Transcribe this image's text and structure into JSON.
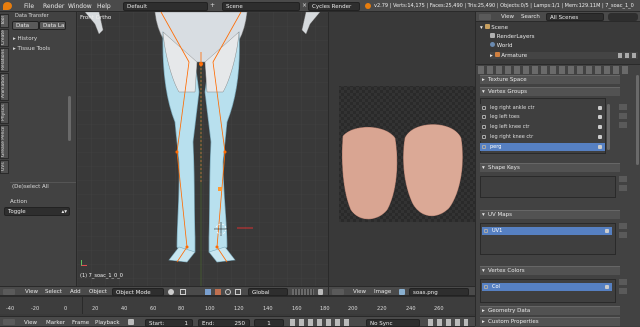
{
  "topbar": {
    "menus": [
      "File",
      "Render",
      "Window",
      "Help"
    ],
    "layout": "Default",
    "scene": "Scene",
    "engine": "Cycles Render",
    "stats": "v2.79 | Verts:14,175 | Faces:25,490 | Tris:25,490 | Objects:0/5 | Lamps:1/1 | Mem:129.11M | 7_soac_1_0"
  },
  "toolshelf": {
    "tabs": [
      "Tool",
      "Create",
      "Relations",
      "Animation",
      "Physics",
      "Grease Pencil",
      "UVs"
    ],
    "data_transfer": "Data Transfer",
    "data_btn": "Data",
    "data_la_btn": "Data La",
    "history": "History",
    "tissue_tools": "Tissue Tools",
    "operator_title": "(De)select All",
    "action_label": "Action",
    "action_value": "Toggle"
  },
  "viewport": {
    "label": "Front Ortho",
    "object_label": "(1) 7_soac_1_0_0",
    "header": {
      "view": "View",
      "select": "Select",
      "add": "Add",
      "object": "Object",
      "mode": "Object Mode",
      "orientation": "Global"
    }
  },
  "image_editor": {
    "header": {
      "view": "View",
      "image": "Image",
      "image_name": "soas.png"
    }
  },
  "outliner": {
    "view": "View",
    "search": "Search",
    "filter": "All Scenes",
    "items": [
      "Scene",
      "RenderLayers",
      "World",
      "Armature"
    ]
  },
  "properties": {
    "texture_space": "Texture Space",
    "vertex_groups": "Vertex Groups",
    "groups": [
      "leg right ankle ctr",
      "leg left toes",
      "leg left knee ctr",
      "leg right knee ctr",
      "perg"
    ],
    "selected_group": "perg",
    "shape_keys": "Shape Keys",
    "uv_maps": "UV Maps",
    "uv_item": "UV1",
    "vertex_colors": "Vertex Colors",
    "col_item": "Col",
    "geometry_data": "Geometry Data",
    "custom_properties": "Custom Properties"
  },
  "timeline": {
    "ticks": [
      "-40",
      "-20",
      "0",
      "20",
      "40",
      "60",
      "80",
      "100",
      "120",
      "140",
      "160",
      "180",
      "200",
      "220",
      "240",
      "260"
    ],
    "view": "View",
    "marker": "Marker",
    "frame": "Frame",
    "playback": "Playback",
    "start_label": "Start:",
    "start_value": "1",
    "end_label": "End:",
    "end_value": "250",
    "current_frame": "1",
    "sync": "No Sync"
  },
  "colors": {
    "accent": "#5680c2",
    "leg": "#aed6e8",
    "bone": "#ff6a00"
  }
}
